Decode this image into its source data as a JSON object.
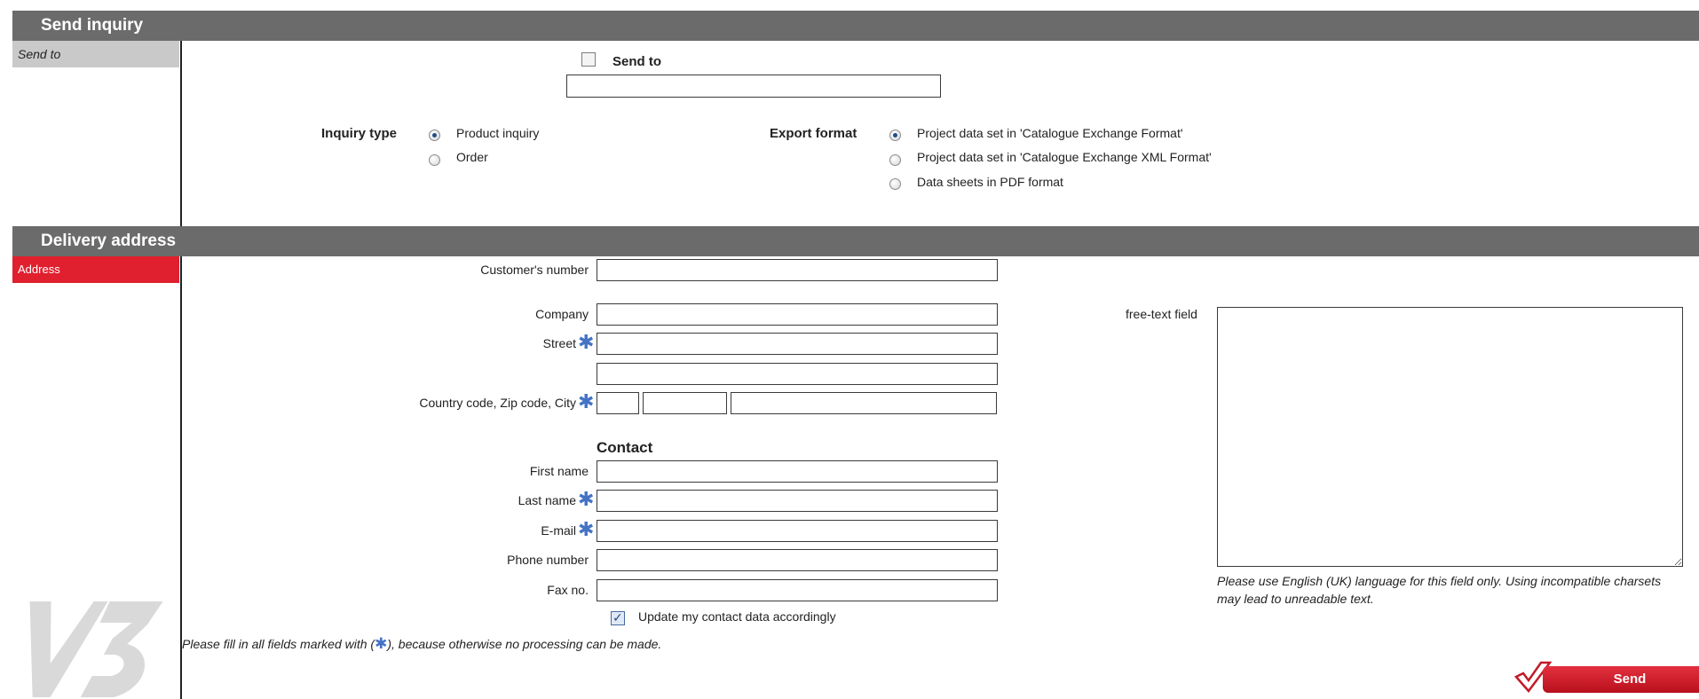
{
  "sections": {
    "send_inquiry": "Send inquiry",
    "delivery_address": "Delivery address"
  },
  "sidebar": {
    "send_to": "Send to",
    "address": "Address"
  },
  "send_to": {
    "label": "Send to",
    "checked": false,
    "value": ""
  },
  "inquiry_type": {
    "label": "Inquiry type",
    "options": [
      "Product inquiry",
      "Order"
    ],
    "selected": "Product inquiry"
  },
  "export_format": {
    "label": "Export format",
    "options": [
      "Project data set in 'Catalogue Exchange Format'",
      "Project data set in 'Catalogue Exchange XML Format'",
      "Data sheets in PDF format"
    ],
    "selected": "Project data set in 'Catalogue Exchange Format'"
  },
  "address": {
    "customers_number": "Customer's number",
    "company": "Company",
    "street": "Street",
    "country_zip_city": "Country code, Zip code, City"
  },
  "contact": {
    "heading": "Contact",
    "first_name": "First name",
    "last_name": "Last name",
    "email": "E-mail",
    "phone": "Phone number",
    "fax": "Fax no.",
    "update_label": "Update my contact data accordingly",
    "update_checked": true
  },
  "free_text": {
    "label": "free-text field",
    "note": "Please use English (UK) language for this field only. Using incompatible charsets may lead to unreadable text."
  },
  "required_note_before": "Please fill in all fields marked with (",
  "required_note_after": "), because otherwise no processing can be made.",
  "send_button": "Send",
  "logo": "V3",
  "colors": {
    "header_bar": "#6b6b6b",
    "active_sidebar": "#e0202f",
    "inactive_sidebar": "#c9c9c9",
    "required_star": "#4473c4",
    "send_button": "#d81f2d"
  },
  "icons": {
    "required": "blue-asterisk-icon",
    "send": "checkmark-icon"
  }
}
